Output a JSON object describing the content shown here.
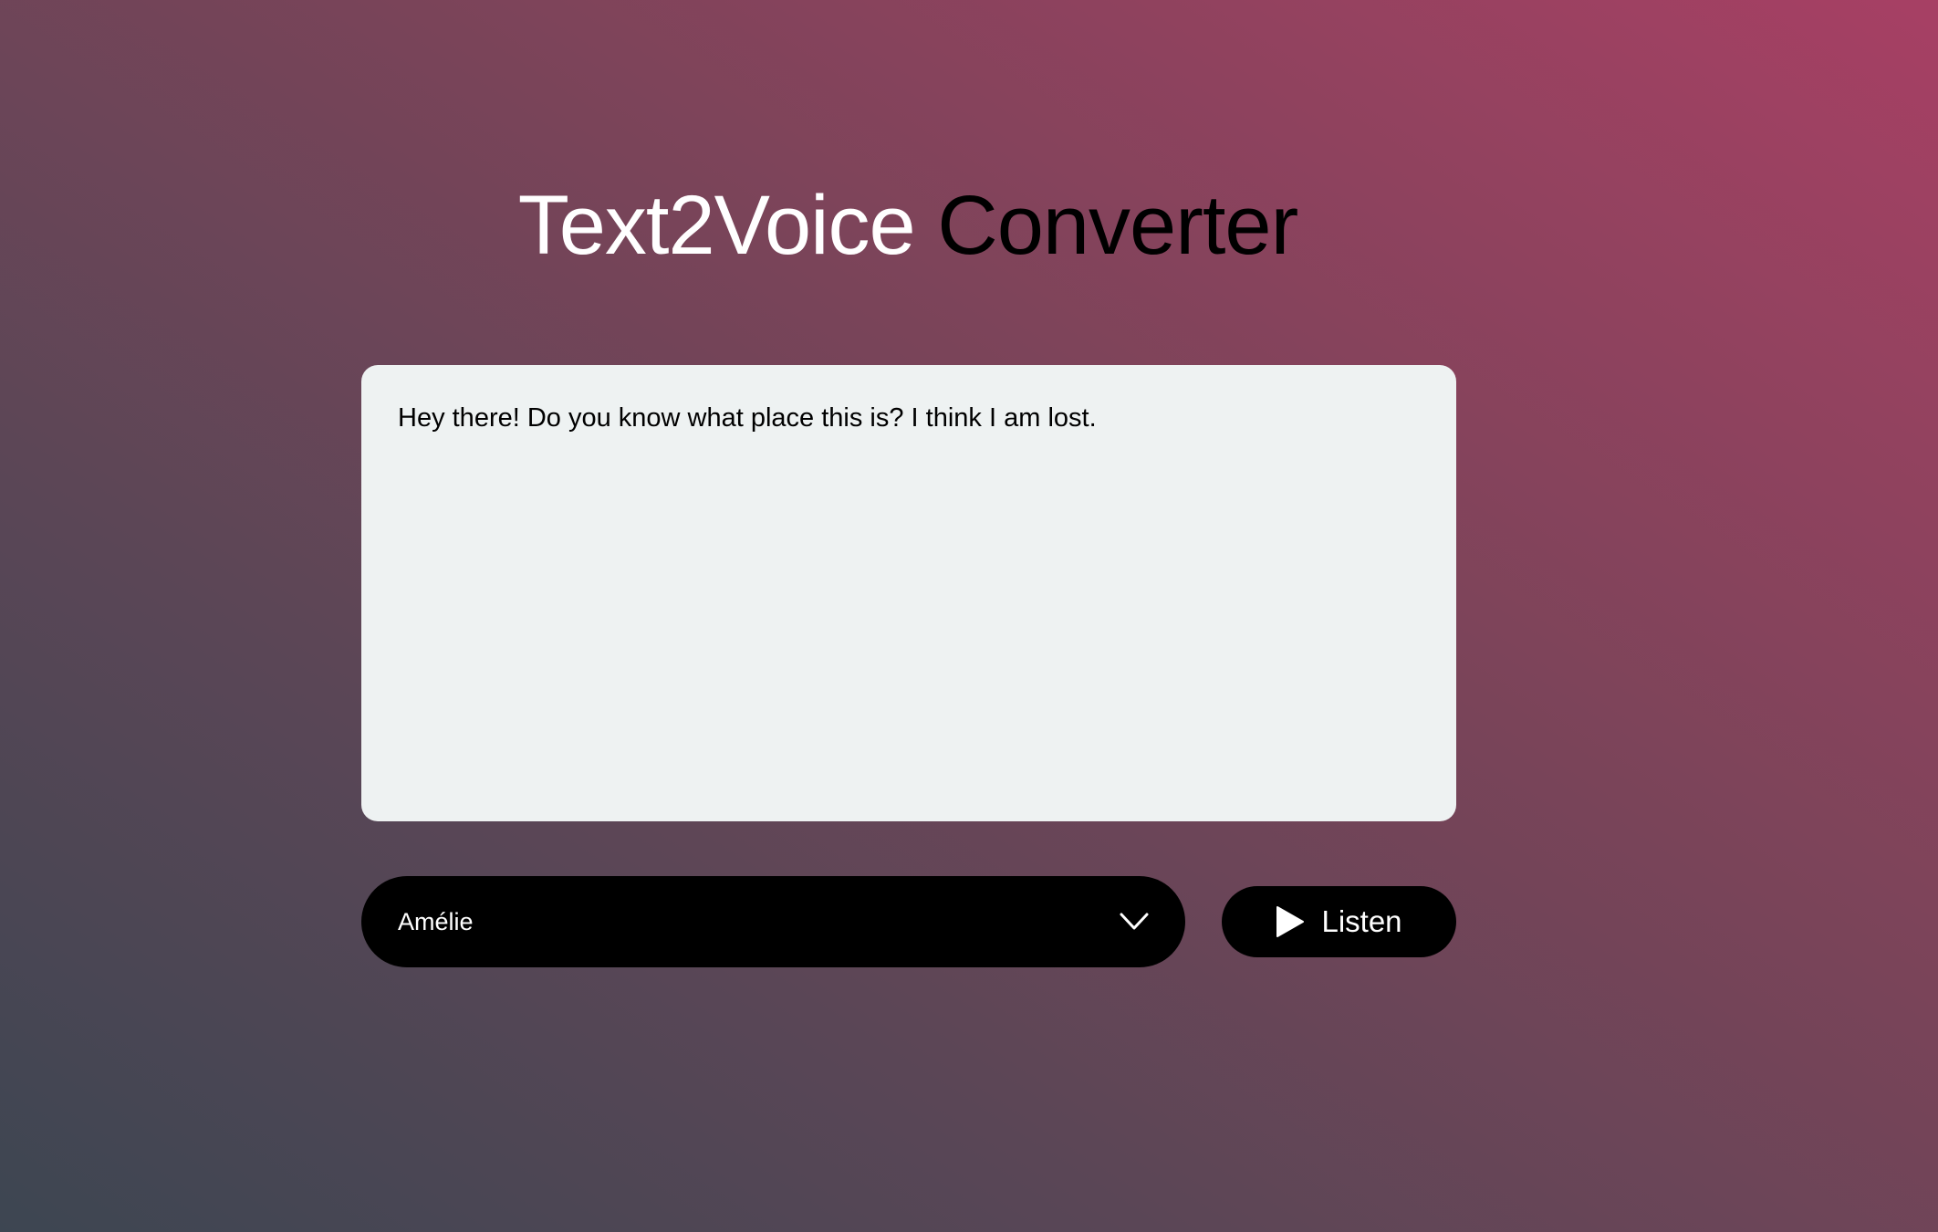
{
  "header": {
    "title_part1": "Text2Voice",
    "title_part2": "Converter"
  },
  "editor": {
    "text": "Hey there! Do you know what place this is? I think I am lost."
  },
  "voice_select": {
    "selected": "Amélie",
    "icon": "chevron-down-icon"
  },
  "listen_button": {
    "label": "Listen",
    "icon": "play-icon"
  },
  "colors": {
    "gradient_start": "#3d4652",
    "gradient_end": "#a74064",
    "textbox_bg": "#eef2f2",
    "control_bg": "#000000",
    "accent_text": "#ffffff"
  }
}
